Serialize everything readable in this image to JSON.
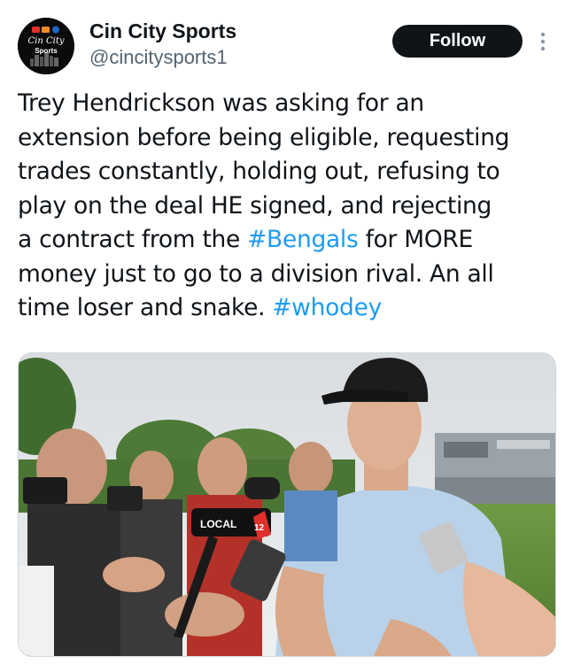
{
  "author": {
    "display_name": "Cin City Sports",
    "handle": "@cincitysports1",
    "avatar_text_top": "Cin City",
    "avatar_text_bottom": "Sports"
  },
  "actions": {
    "follow_label": "Follow",
    "more_icon": "vertical-ellipsis-icon"
  },
  "tweet": {
    "lines": [
      {
        "pre": "Trey Hendrickson was asking for an"
      },
      {
        "pre": "extension before being eligible, requesting"
      },
      {
        "pre": "trades constantly, holding out, refusing to"
      },
      {
        "pre": "play on the deal HE signed, and rejecting"
      },
      {
        "pre": "a contract from the ",
        "tag": "#Bengals",
        "post": " for MORE"
      },
      {
        "pre": "money just to go to a division rival. An all"
      },
      {
        "pre": "time loser and snake. ",
        "tag": "#whodey"
      }
    ]
  },
  "media": {
    "mic_flag_text": "LOCAL",
    "mic_flag_number": "12"
  },
  "colors": {
    "text": "#0f1419",
    "secondary": "#536471",
    "link": "#1d9bf0",
    "follow_bg": "#0f1419"
  }
}
